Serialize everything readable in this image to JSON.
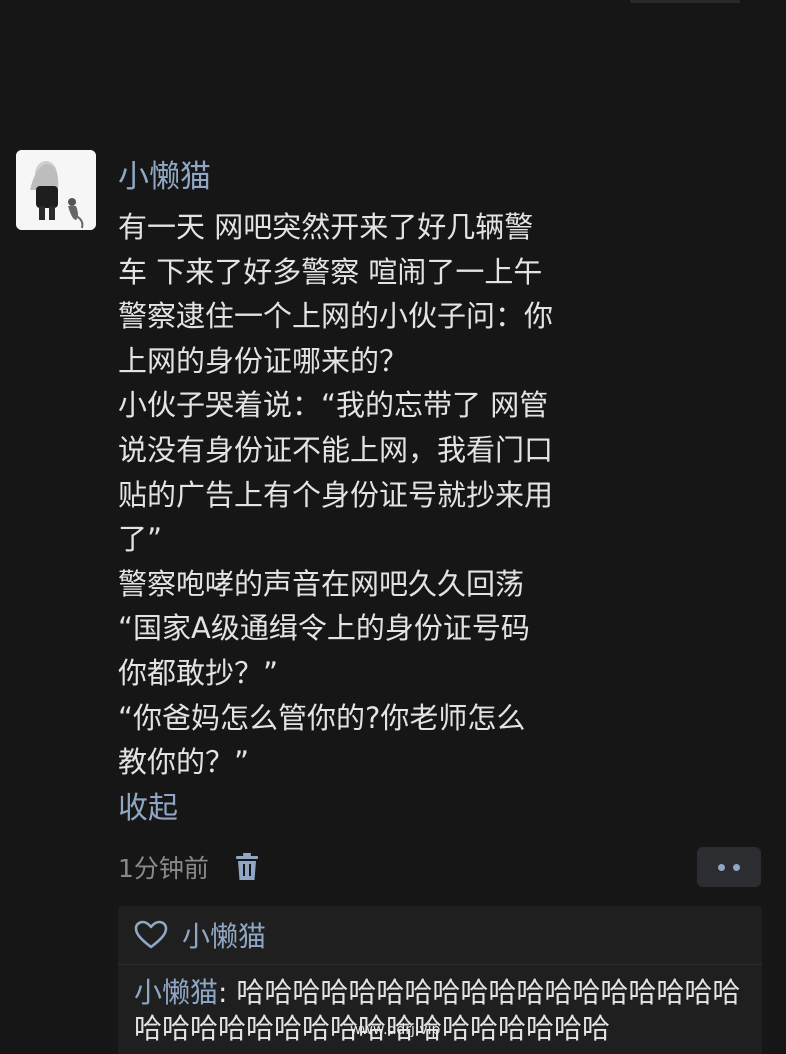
{
  "post": {
    "author": "小懒猫",
    "lines": [
      "有一天 网吧突然开来了好几辆警",
      "车 下来了好多警察 喧闹了一上午",
      "警察逮住一个上网的小伙子问：你",
      "上网的身份证哪来的？",
      "小伙子哭着说：“我的忘带了 网管",
      "说没有身份证不能上网，我看门口",
      "贴的广告上有个身份证号就抄来用",
      "了”",
      "警察咆哮的声音在网吧久久回荡",
      "“国家A级通缉令上的身份证号码",
      "你都敢抄？”",
      "“你爸妈怎么管你的?你老师怎么",
      "教你的？”"
    ],
    "collapse_label": "收起",
    "time": "1分钟前"
  },
  "replies": {
    "liked_by": "小懒猫",
    "reply_author": "小懒猫",
    "reply_separator": ": ",
    "reply_text": "哈哈哈哈哈哈哈哈哈哈哈哈哈哈哈哈哈哈哈哈哈哈哈哈哈哈哈哈哈哈哈哈哈哈哈"
  },
  "watermark": "www.ddrj.vip",
  "icons": {
    "trash": "trash-icon",
    "more": "more-dots-icon",
    "heart": "heart-icon"
  },
  "colors": {
    "accent": "#8fa7c4",
    "background": "#161616",
    "text": "#e3e3e3"
  }
}
